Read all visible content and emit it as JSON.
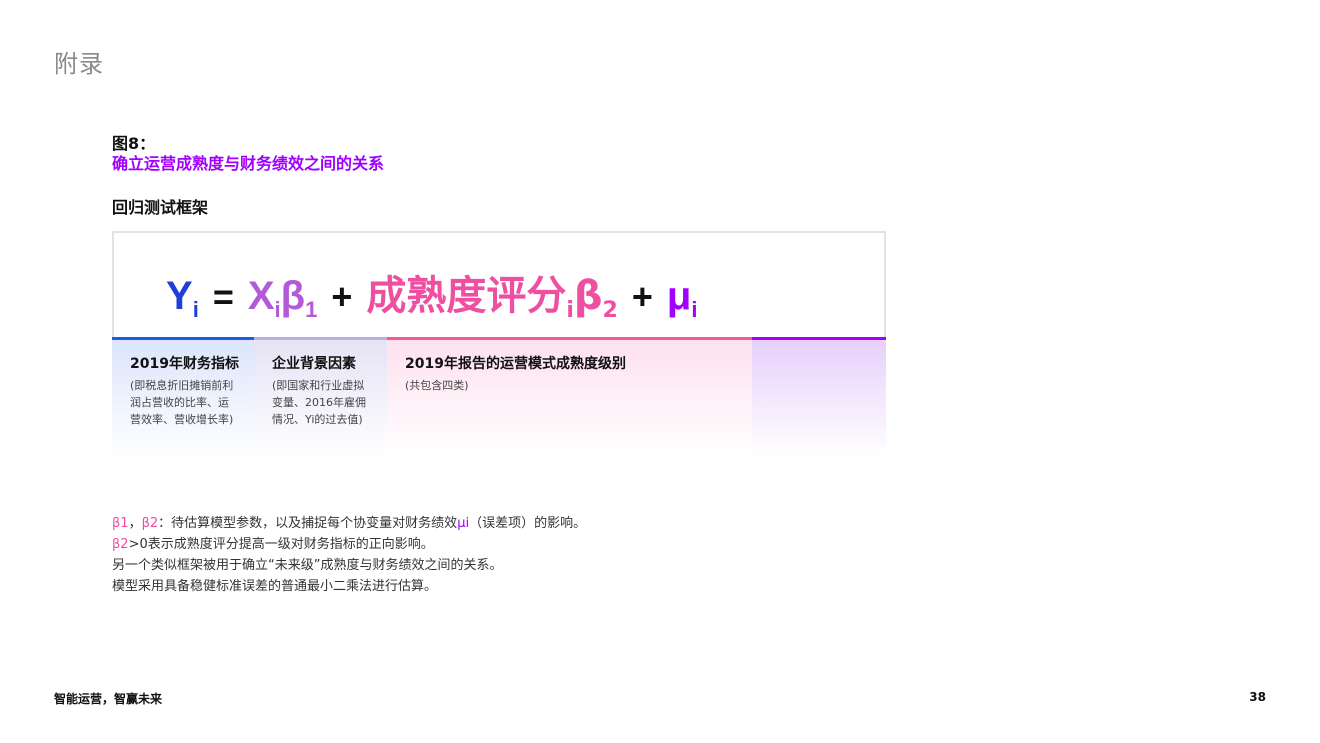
{
  "section_header": "附录",
  "figure": {
    "label": "图8：",
    "title": "确立运营成熟度与财务绩效之间的关系",
    "subheading": "回归测试框架"
  },
  "equation": {
    "y": "Y",
    "y_sub": "i",
    "eq": "=",
    "x": "X",
    "x_sub": "i",
    "beta1": "β",
    "beta1_sub": "1",
    "plus1": "+",
    "score": "成熟度评分",
    "score_sub": "i",
    "beta2": "β",
    "beta2_sub": "2",
    "plus2": "+",
    "mu": "μ",
    "mu_sub": "i",
    "colors": {
      "y": "#1f3fd6",
      "x": "#b25ad8",
      "score": "#ee4fa1",
      "mu": "#a100ff"
    }
  },
  "columns": [
    {
      "title": "2019年财务指标",
      "desc": [
        "(即税息折旧摊销前利",
        "润占营收的比率、运",
        "营效率、营收增长率)"
      ]
    },
    {
      "title": "企业背景因素",
      "desc": [
        "(即国家和行业虚拟",
        "变量、2016年雇佣",
        "情况、Yi的过去值)"
      ]
    },
    {
      "title": "2019年报告的运营模式成熟度级别",
      "desc": [
        "(共包含四类)"
      ]
    },
    {
      "title": "",
      "desc": []
    }
  ],
  "notes": {
    "line1": {
      "b1": "β1",
      "sep": "，",
      "b2": "β2",
      "text_a": "：待估算模型参数，以及捕捉每个协变量对财务绩效",
      "mu": "μi",
      "text_b": "（误差项）的影响。"
    },
    "line2": {
      "b2": "β2",
      "text": ">0表示成熟度评分提高一级对财务指标的正向影响。"
    },
    "line3": "另一个类似框架被用于确立“未来级”成熟度与财务绩效之间的关系。",
    "line4": "模型采用具备稳健标准误差的普通最小二乘法进行估算。"
  },
  "footer": {
    "left": "智能运营，智赢未来",
    "page_number": "38"
  }
}
